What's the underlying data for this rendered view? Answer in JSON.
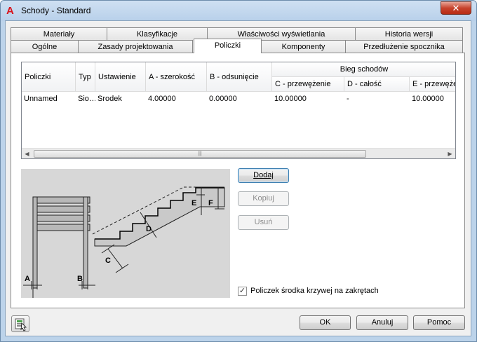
{
  "window": {
    "title": "Schody - Standard",
    "close_glyph": "✕",
    "app_icon": "autocad-a-icon"
  },
  "tabs_row1": [
    "Materiały",
    "Klasyfikacje",
    "Właściwości wyświetlania",
    "Historia wersji"
  ],
  "tabs_row2": [
    "Ogólne",
    "Zasady projektowania",
    "Policzki",
    "Komponenty",
    "Przedłużenie spocznika"
  ],
  "active_tab": "Policzki",
  "grid": {
    "group_header": "Bieg schodów",
    "columns": [
      "Policzki",
      "Typ",
      "Ustawienie",
      "A - szerokość",
      "B - odsunięcie",
      "C - przewężenie",
      "D - całość",
      "E - przewęże"
    ],
    "rows": [
      [
        "Unnamed",
        "Sio…",
        "Środek",
        "4.00000",
        "0.00000",
        "10.00000",
        "-",
        "10.00000"
      ]
    ]
  },
  "buttons": {
    "add": "Dodaj",
    "copy": "Kopiuj",
    "delete": "Usuń",
    "ok": "OK",
    "cancel": "Anuluj",
    "help": "Pomoc"
  },
  "checkbox": {
    "label": "Policzek środka krzywej na zakrętach",
    "checked": true
  },
  "illustration": {
    "labels": [
      "A",
      "B",
      "C",
      "D",
      "E",
      "F"
    ]
  }
}
